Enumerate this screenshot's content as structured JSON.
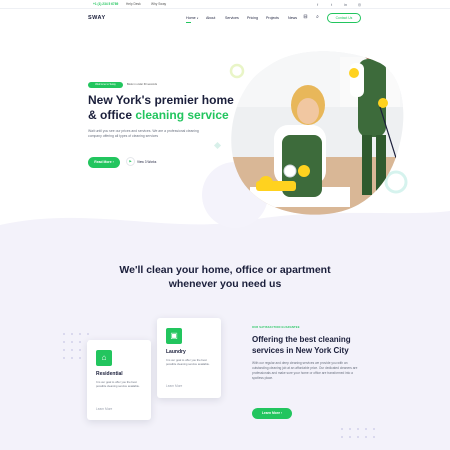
{
  "topbar": {
    "phone": "+1 (1) 234 5 6789",
    "help_desk": "Help Desk",
    "why_sway": "Why Sway",
    "social_icons": [
      "facebook-icon",
      "twitter-icon",
      "linkedin-icon",
      "instagram-icon"
    ]
  },
  "nav": {
    "logo": "SWAY",
    "items": [
      "Home",
      "About",
      "Services",
      "Pricing",
      "Projects",
      "News"
    ],
    "contact_label": "Contact Us",
    "icons": [
      "cart-icon",
      "search-icon"
    ]
  },
  "hero": {
    "badge_label": "Welcome to Sway",
    "badge_text": "Book in under 60 seconds",
    "title_line1": "New York's premier home",
    "title_line2_prefix": "& office ",
    "title_accent": "cleaning service",
    "description": "Wait until you see our prices and services. We are a professional cleaning company offering all types of cleaning services",
    "cta_label": "Read More",
    "video_label": "View 3 Works"
  },
  "headline": {
    "line1": "We'll clean your home, office or apartment",
    "line2": "whenever you need us"
  },
  "cards": [
    {
      "title": "Residential",
      "description": "It is our goal to offer you the best possible cleaning service available.",
      "link": "Learn More",
      "icon": "house-icon"
    },
    {
      "title": "Laundry",
      "description": "It is our goal to offer you the best possible cleaning service available.",
      "link": "Learn More",
      "icon": "laundry-icon"
    }
  ],
  "satisfaction": {
    "eyebrow": "OUR SATISFACTION GUARANTEE",
    "title": "Offering the best cleaning services in New York City",
    "description": "With our regular and deep cleaning services we provide you with an outstanding cleaning job at an affordable price. Our dedicated cleaners are professionals and make sure your home or office are transformed into a spotless place.",
    "cta_label": "Learn More"
  },
  "colors": {
    "accent": "#22c55e",
    "text": "#1b1f3b",
    "muted": "#6b7280",
    "lavender": "#f3f2fa"
  }
}
